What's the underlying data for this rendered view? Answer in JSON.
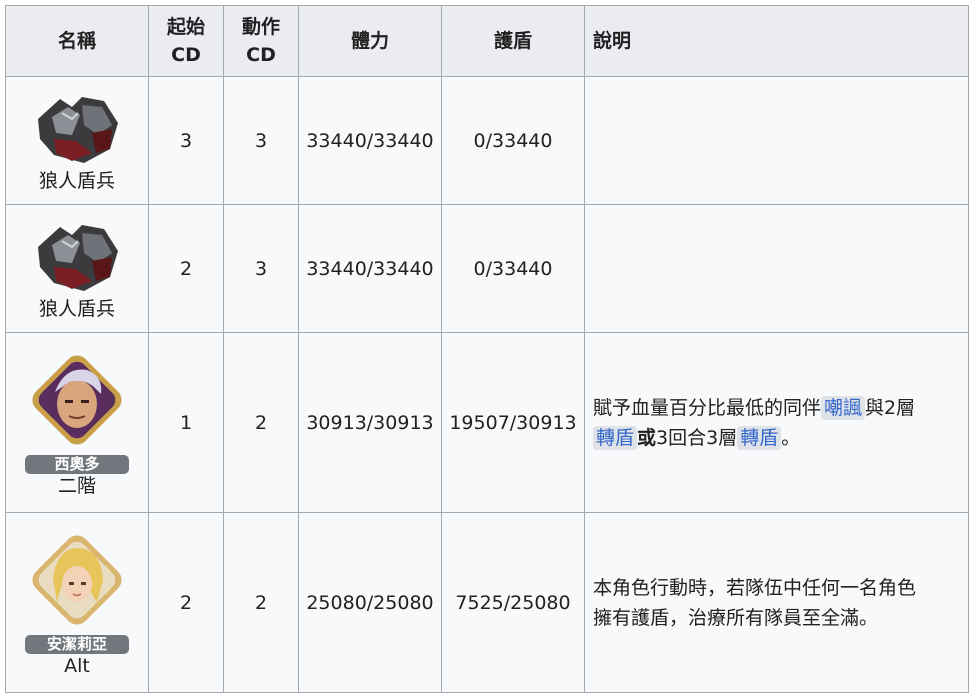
{
  "headers": {
    "name": "名稱",
    "start_cd_1": "起始",
    "start_cd_2": "CD",
    "action_cd_1": "動作",
    "action_cd_2": "CD",
    "hp": "體力",
    "shield": "護盾",
    "desc": "說明"
  },
  "rows": [
    {
      "name": "狼人盾兵",
      "start_cd": "3",
      "action_cd": "3",
      "hp": "33440/33440",
      "shield": "0/33440"
    },
    {
      "name": "狼人盾兵",
      "start_cd": "2",
      "action_cd": "3",
      "hp": "33440/33440",
      "shield": "0/33440"
    },
    {
      "badge": "西奧多",
      "name": "二階",
      "start_cd": "1",
      "action_cd": "2",
      "hp": "30913/30913",
      "shield": "19507/30913",
      "desc": {
        "t1": "賦予血量百分比最低的同伴",
        "link1": "嘲諷",
        "t2": "與2層",
        "link2": "轉盾",
        "t3": "或",
        "t4": "3回合3層",
        "link3": "轉盾",
        "t5": "。"
      }
    },
    {
      "badge": "安潔莉亞",
      "name": "Alt",
      "start_cd": "2",
      "action_cd": "2",
      "hp": "25080/25080",
      "shield": "7525/25080",
      "desc": {
        "t1": "本角色行動時，若隊伍中任何一名角色",
        "t2": "擁有護盾，治療所有隊員至全滿。"
      }
    }
  ]
}
